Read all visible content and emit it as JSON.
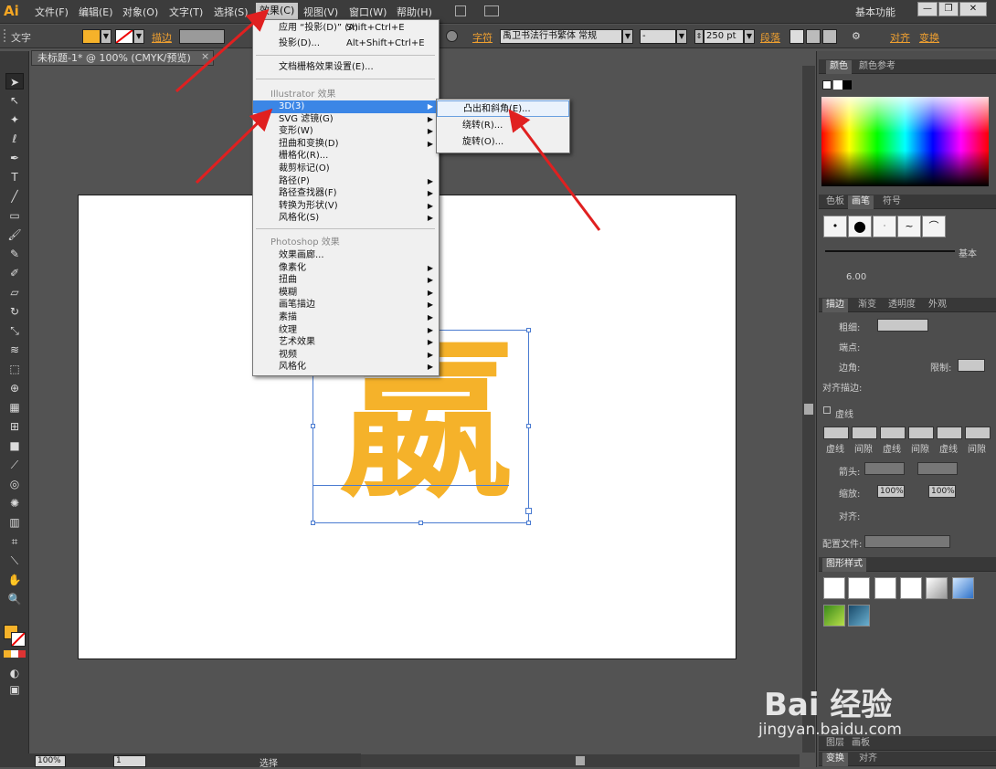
{
  "app": {
    "logo": "Ai",
    "workspace": "基本功能"
  },
  "menubar": {
    "items": [
      "文件(F)",
      "编辑(E)",
      "对象(O)",
      "文字(T)",
      "选择(S)",
      "效果(C)",
      "视图(V)",
      "窗口(W)",
      "帮助(H)"
    ]
  },
  "window_buttons": [
    "—",
    "❐",
    "✕"
  ],
  "controlbar": {
    "type_label": "文字",
    "stroke_label": "描边",
    "char_label": "字符",
    "font_name": "禹卫书法行书繁体 常规",
    "font_size": "250 pt",
    "para_label": "段落",
    "align_label": "对齐",
    "transform_label": "变换",
    "fill_color": "#f5b22a"
  },
  "document": {
    "tab_title": "未标题-1* @ 100% (CMYK/预览)",
    "close": "×"
  },
  "artwork": {
    "glyph": "嬴",
    "color": "#f5b22a"
  },
  "statusbar": {
    "zoom": "100%",
    "page": "1",
    "status": "选择"
  },
  "effect_menu": {
    "apply_label": "应用 “投影(D)” (A)",
    "apply_shortcut": "Shift+Ctrl+E",
    "shadow_label": "投影(D)...",
    "shadow_shortcut": "Alt+Shift+Ctrl+E",
    "raster_settings": "文档栅格效果设置(E)...",
    "illustrator_header": "Illustrator 效果",
    "illustrator_items": [
      {
        "label": "3D(3)",
        "sub": true
      },
      {
        "label": "SVG 滤镜(G)",
        "sub": true
      },
      {
        "label": "变形(W)",
        "sub": true
      },
      {
        "label": "扭曲和变换(D)",
        "sub": true
      },
      {
        "label": "栅格化(R)...",
        "sub": false
      },
      {
        "label": "裁剪标记(O)",
        "sub": false
      },
      {
        "label": "路径(P)",
        "sub": true
      },
      {
        "label": "路径查找器(F)",
        "sub": true
      },
      {
        "label": "转换为形状(V)",
        "sub": true
      },
      {
        "label": "风格化(S)",
        "sub": true
      }
    ],
    "photoshop_header": "Photoshop 效果",
    "photoshop_items": [
      {
        "label": "效果画廊...",
        "sub": false
      },
      {
        "label": "像素化",
        "sub": true
      },
      {
        "label": "扭曲",
        "sub": true
      },
      {
        "label": "模糊",
        "sub": true
      },
      {
        "label": "画笔描边",
        "sub": true
      },
      {
        "label": "素描",
        "sub": true
      },
      {
        "label": "纹理",
        "sub": true
      },
      {
        "label": "艺术效果",
        "sub": true
      },
      {
        "label": "视频",
        "sub": true
      },
      {
        "label": "风格化",
        "sub": true
      }
    ]
  },
  "submenu_3d": {
    "items": [
      "凸出和斜角(E)...",
      "绕转(R)...",
      "旋转(O)..."
    ]
  },
  "panels": {
    "color_tabs": [
      "颜色",
      "颜色参考"
    ],
    "swatch_tabs": [
      "色板",
      "画笔",
      "符号"
    ],
    "brush_basic": "基本",
    "brush_size": "6.00",
    "stroke_tabs": [
      "描边",
      "渐变",
      "透明度",
      "外观"
    ],
    "stroke_weight": "粗细:",
    "cap": "端点:",
    "corner": "边角:",
    "limit": "限制:",
    "align_stroke": "对齐描边:",
    "dashed": "虚线",
    "dash_labels": [
      "虚线",
      "间隙",
      "虚线",
      "间隙",
      "虚线",
      "间隙"
    ],
    "arrowheads": "箭头:",
    "scale": "缩放:",
    "scale_val1": "100%",
    "scale_val2": "100%",
    "align": "对齐:",
    "profile": "配置文件:",
    "graphic_styles": "图形样式",
    "bottom_tabs_1": [
      "图层",
      "画板"
    ],
    "bottom_tabs_2": [
      "变换",
      "对齐"
    ]
  },
  "watermark": {
    "logo": "Bai 经验",
    "url": "jingyan.baidu.com"
  }
}
